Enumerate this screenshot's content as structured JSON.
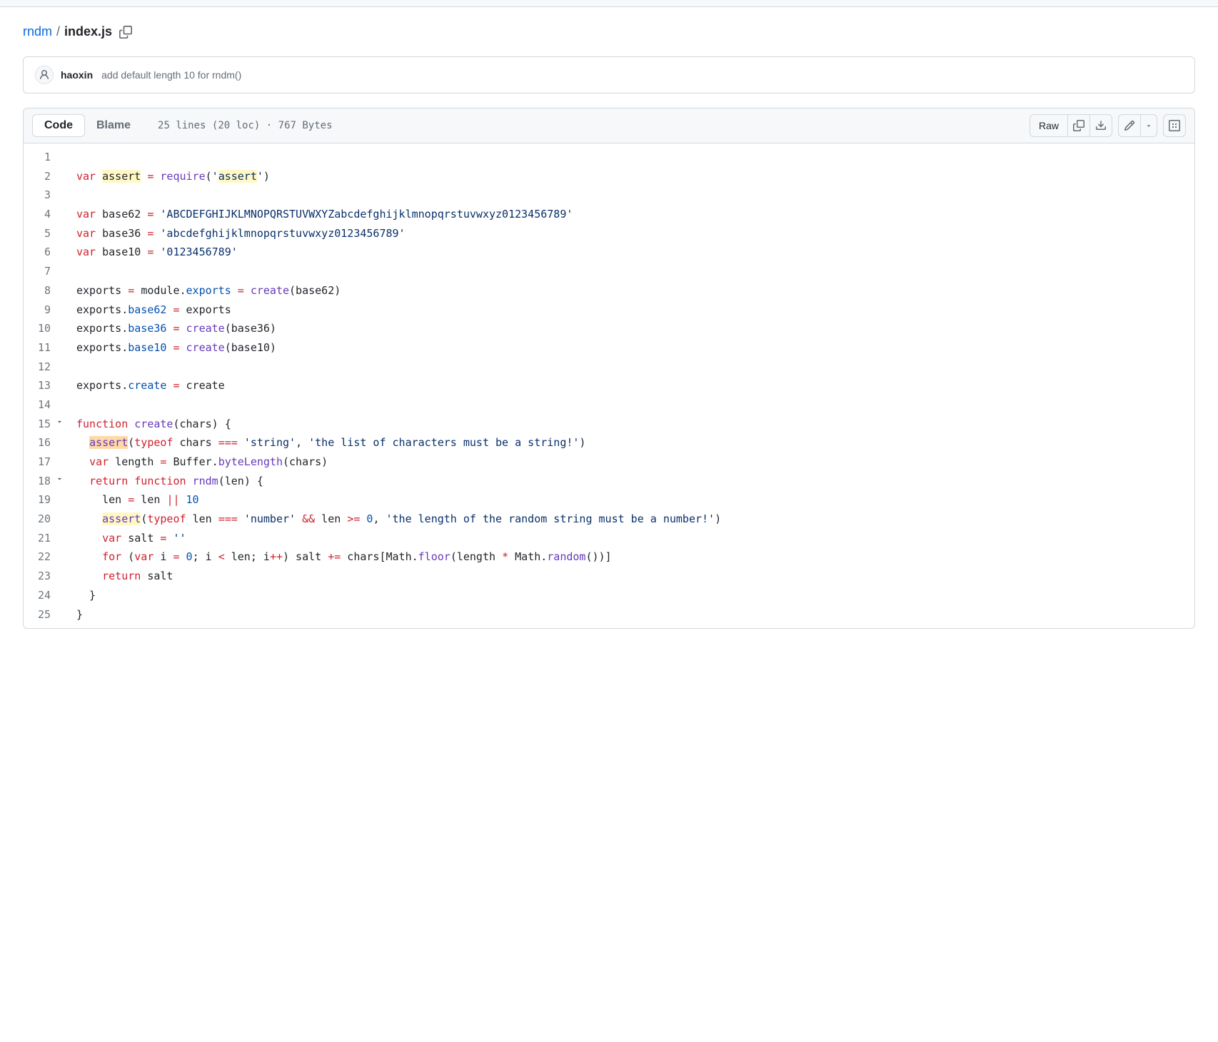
{
  "breadcrumb": {
    "repo": "rndm",
    "sep": "/",
    "file": "index.js"
  },
  "commit": {
    "author": "haoxin",
    "message": "add default length 10 for rndm()"
  },
  "tabs": {
    "code": "Code",
    "blame": "Blame"
  },
  "fileinfo": {
    "lines": "25 lines (20 loc)",
    "dot": "·",
    "size": "767 Bytes"
  },
  "toolbar": {
    "raw": "Raw"
  },
  "code": {
    "lines": [
      {
        "n": "1",
        "html": ""
      },
      {
        "n": "2",
        "html": "<span class='pl-k'>var</span> <span class='hl-yellow'>assert</span> <span class='pl-k'>=</span> <span class='pl-en'>require</span>(<span class='pl-s'>'<span class='hl-yellow'>assert</span>'</span>)"
      },
      {
        "n": "3",
        "html": ""
      },
      {
        "n": "4",
        "html": "<span class='pl-k'>var</span> <span class='pl-smi'>base62</span> <span class='pl-k'>=</span> <span class='pl-s'>'ABCDEFGHIJKLMNOPQRSTUVWXYZabcdefghijklmnopqrstuvwxyz0123456789'</span>"
      },
      {
        "n": "5",
        "html": "<span class='pl-k'>var</span> <span class='pl-smi'>base36</span> <span class='pl-k'>=</span> <span class='pl-s'>'abcdefghijklmnopqrstuvwxyz0123456789'</span>"
      },
      {
        "n": "6",
        "html": "<span class='pl-k'>var</span> <span class='pl-smi'>base10</span> <span class='pl-k'>=</span> <span class='pl-s'>'0123456789'</span>"
      },
      {
        "n": "7",
        "html": ""
      },
      {
        "n": "8",
        "html": "<span class='pl-smi'>exports</span> <span class='pl-k'>=</span> <span class='pl-smi'>module</span>.<span class='pl-c1'>exports</span> <span class='pl-k'>=</span> <span class='pl-en'>create</span>(base62)"
      },
      {
        "n": "9",
        "html": "<span class='pl-smi'>exports</span>.<span class='pl-c1'>base62</span> <span class='pl-k'>=</span> exports"
      },
      {
        "n": "10",
        "html": "<span class='pl-smi'>exports</span>.<span class='pl-c1'>base36</span> <span class='pl-k'>=</span> <span class='pl-en'>create</span>(base36)"
      },
      {
        "n": "11",
        "html": "<span class='pl-smi'>exports</span>.<span class='pl-c1'>base10</span> <span class='pl-k'>=</span> <span class='pl-en'>create</span>(base10)"
      },
      {
        "n": "12",
        "html": ""
      },
      {
        "n": "13",
        "html": "<span class='pl-smi'>exports</span>.<span class='pl-c1'>create</span> <span class='pl-k'>=</span> create"
      },
      {
        "n": "14",
        "html": ""
      },
      {
        "n": "15",
        "fold": true,
        "html": "<span class='pl-k'>function</span> <span class='pl-en'>create</span>(<span class='pl-smi'>chars</span>) {"
      },
      {
        "n": "16",
        "html": "  <span class='hl-orange pl-en'>assert</span>(<span class='pl-k'>typeof</span> <span class='pl-smi'>chars</span> <span class='pl-k'>===</span> <span class='pl-s'>'string'</span>, <span class='pl-s'>'the list of characters must be a string!'</span>)"
      },
      {
        "n": "17",
        "html": "  <span class='pl-k'>var</span> <span class='pl-smi'>length</span> <span class='pl-k'>=</span> <span class='pl-smi'>Buffer</span>.<span class='pl-en'>byteLength</span>(chars)"
      },
      {
        "n": "18",
        "fold": true,
        "html": "  <span class='pl-k'>return</span> <span class='pl-k'>function</span> <span class='pl-en'>rndm</span>(<span class='pl-smi'>len</span>) {"
      },
      {
        "n": "19",
        "html": "    <span class='pl-smi'>len</span> <span class='pl-k'>=</span> len <span class='pl-k'>||</span> <span class='pl-c1'>10</span>"
      },
      {
        "n": "20",
        "html": "    <span class='hl-yellow pl-en'>assert</span>(<span class='pl-k'>typeof</span> <span class='pl-smi'>len</span> <span class='pl-k'>===</span> <span class='pl-s'>'number'</span> <span class='pl-k'>&amp;&amp;</span> len <span class='pl-k'>&gt;=</span> <span class='pl-c1'>0</span>, <span class='pl-s'>'the length of the random string must be a number!'</span>)"
      },
      {
        "n": "21",
        "html": "    <span class='pl-k'>var</span> <span class='pl-smi'>salt</span> <span class='pl-k'>=</span> <span class='pl-s'>''</span>"
      },
      {
        "n": "22",
        "html": "    <span class='pl-k'>for</span> (<span class='pl-k'>var</span> <span class='pl-smi'>i</span> <span class='pl-k'>=</span> <span class='pl-c1'>0</span>; i <span class='pl-k'>&lt;</span> len; i<span class='pl-k'>++</span>) salt <span class='pl-k'>+=</span> chars[<span class='pl-smi'>Math</span>.<span class='pl-en'>floor</span>(length <span class='pl-k'>*</span> <span class='pl-smi'>Math</span>.<span class='pl-en'>random</span>())]"
      },
      {
        "n": "23",
        "html": "    <span class='pl-k'>return</span> salt"
      },
      {
        "n": "24",
        "html": "  }"
      },
      {
        "n": "25",
        "html": "}"
      }
    ]
  }
}
